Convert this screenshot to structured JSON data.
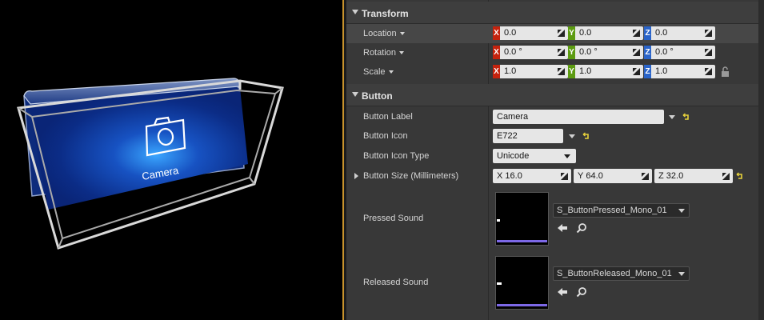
{
  "viewport": {
    "button_text": "Camera",
    "icon_name": "camera-icon"
  },
  "transform": {
    "title": "Transform",
    "location": {
      "label": "Location",
      "x": "0.0",
      "y": "0.0",
      "z": "0.0"
    },
    "rotation": {
      "label": "Rotation",
      "x": "0.0 °",
      "y": "0.0 °",
      "z": "0.0 °"
    },
    "scale": {
      "label": "Scale",
      "x": "1.0",
      "y": "1.0",
      "z": "1.0"
    },
    "axis": {
      "x": "X",
      "y": "Y",
      "z": "Z"
    }
  },
  "button": {
    "title": "Button",
    "label_row": {
      "label": "Button Label",
      "value": "Camera"
    },
    "icon_row": {
      "label": "Button Icon",
      "value": "E722"
    },
    "icon_type_row": {
      "label": "Button Icon Type",
      "value": "Unicode"
    },
    "size_row": {
      "label": "Button Size (Millimeters)",
      "x": "16.0",
      "y": "64.0",
      "z": "32.0"
    },
    "pressed_row": {
      "label": "Pressed Sound",
      "asset": "S_ButtonPressed_Mono_01"
    },
    "released_row": {
      "label": "Released Sound",
      "asset": "S_ButtonReleased_Mono_01"
    }
  },
  "colors": {
    "accent_orange": "#c7922c",
    "axis_x": "#c4230e",
    "axis_y": "#5c9b11",
    "axis_z": "#2a64c9",
    "reset_yellow": "#e8d23a",
    "audio_bar": "#7c68e6"
  }
}
